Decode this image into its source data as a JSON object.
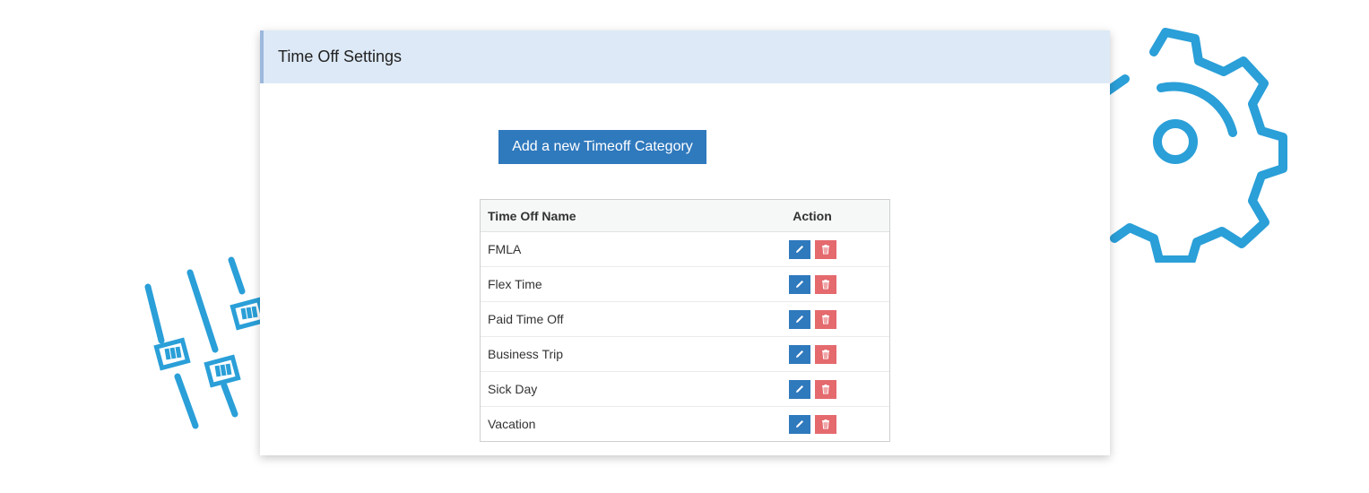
{
  "panel": {
    "title": "Time Off Settings"
  },
  "add_button": {
    "label": "Add a new Timeoff Category"
  },
  "table": {
    "headers": {
      "name": "Time Off Name",
      "action": "Action"
    },
    "rows": [
      {
        "name": "FMLA"
      },
      {
        "name": "Flex Time"
      },
      {
        "name": "Paid Time Off"
      },
      {
        "name": "Business Trip"
      },
      {
        "name": "Sick Day"
      },
      {
        "name": "Vacation"
      }
    ]
  },
  "icons": {
    "edit": "pencil-icon",
    "delete": "trash-icon",
    "decor_gear": "gear-icon",
    "decor_sliders": "sliders-icon"
  },
  "colors": {
    "primary": "#2f79bd",
    "danger": "#e46a6e",
    "header_bg": "#dde9f6",
    "decor": "#2a9fd8"
  }
}
